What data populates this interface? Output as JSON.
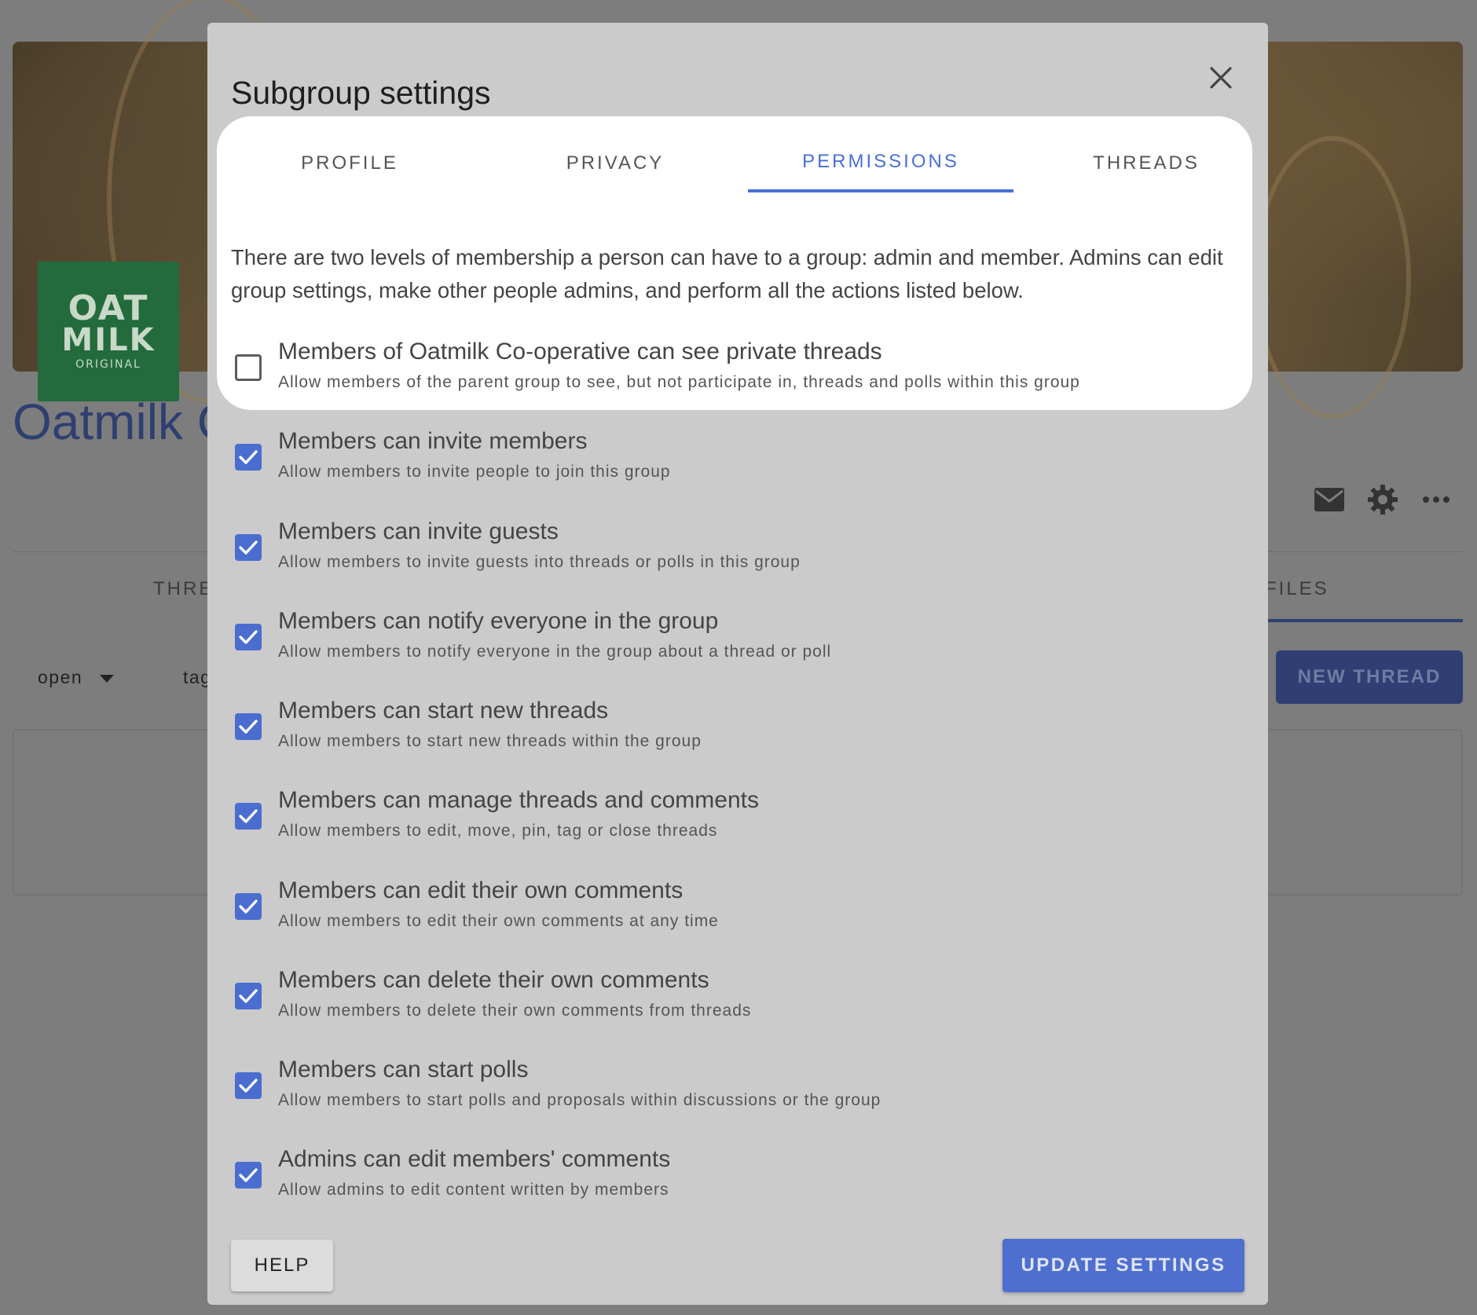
{
  "background": {
    "logo_lines": [
      "OAT",
      "MILK",
      "ORIGINAL"
    ],
    "group_title": "Oatmilk C",
    "tabs": [
      "THRE",
      "FILES"
    ],
    "filters": [
      "open",
      "tag"
    ],
    "new_thread_label": "NEW THREAD",
    "icons": [
      "mail-icon",
      "gear-icon",
      "more-horizontal-icon"
    ]
  },
  "dialog": {
    "title": "Subgroup settings",
    "tabs": [
      {
        "label": "PROFILE",
        "active": false
      },
      {
        "label": "PRIVACY",
        "active": false
      },
      {
        "label": "PERMISSIONS",
        "active": true
      },
      {
        "label": "THREADS",
        "active": false
      }
    ],
    "intro": "There are two levels of membership a person can have to a group: admin and member. Admins can edit group settings, make other people admins, and perform all the actions listed below.",
    "permissions": [
      {
        "label": "Members of Oatmilk Co-operative can see private threads",
        "description": "Allow members of the parent group to see, but not participate in, threads and polls within this group",
        "checked": false
      },
      {
        "label": "Members can invite members",
        "description": "Allow members to invite people to join this group",
        "checked": true
      },
      {
        "label": "Members can invite guests",
        "description": "Allow members to invite guests into threads or polls in this group",
        "checked": true
      },
      {
        "label": "Members can notify everyone in the group",
        "description": "Allow members to notify everyone in the group about a thread or poll",
        "checked": true
      },
      {
        "label": "Members can start new threads",
        "description": "Allow members to start new threads within the group",
        "checked": true
      },
      {
        "label": "Members can manage threads and comments",
        "description": "Allow members to edit, move, pin, tag or close threads",
        "checked": true
      },
      {
        "label": "Members can edit their own comments",
        "description": "Allow members to edit their own comments at any time",
        "checked": true
      },
      {
        "label": "Members can delete their own comments",
        "description": "Allow members to delete their own comments from threads",
        "checked": true
      },
      {
        "label": "Members can start polls",
        "description": "Allow members to start polls and proposals within discussions or the group",
        "checked": true
      },
      {
        "label": "Admins can edit members' comments",
        "description": "Allow admins to edit content written by members",
        "checked": true
      }
    ],
    "help_label": "HELP",
    "update_label": "UPDATE SETTINGS"
  },
  "colors": {
    "accent": "#4b6dcf",
    "overlay_bg": "#7d7d7d",
    "dialog_bg": "#cbcbcb",
    "highlight_bg": "#ffffff"
  }
}
